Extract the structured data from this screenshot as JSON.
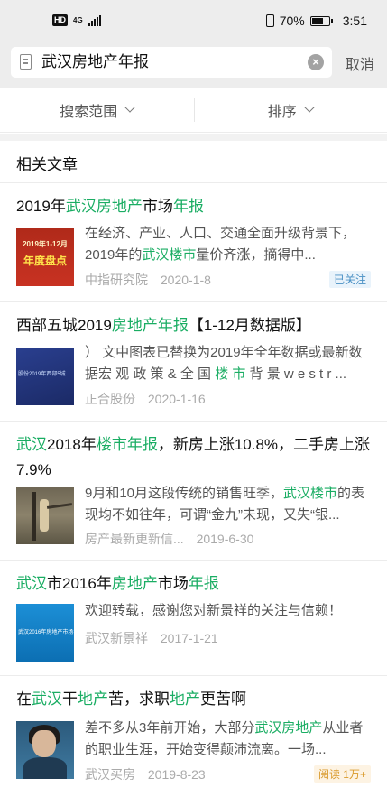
{
  "status_bar": {
    "hd_label": "HD",
    "network_label": "4G",
    "battery_text": "70%",
    "battery_level": 0.7,
    "time": "3:51"
  },
  "search": {
    "query": "武汉房地产年报",
    "cancel_label": "取消"
  },
  "filters": {
    "scope_label": "搜索范围",
    "sort_label": "排序"
  },
  "section_title": "相关文章",
  "articles": [
    {
      "title": [
        {
          "t": "2019年"
        },
        {
          "t": "武汉房地产",
          "hl": true
        },
        {
          "t": "市场"
        },
        {
          "t": "年报",
          "hl": true
        }
      ],
      "thumb_text": [
        "2019年1-12月",
        "年度盘点"
      ],
      "snippet": [
        {
          "t": "在经济、产业、人口、交通全面升级背景下，2019年的"
        },
        {
          "t": "武汉楼市",
          "hl": true
        },
        {
          "t": "量价齐涨，摘得中..."
        }
      ],
      "source": "中指研究院",
      "date": "2020-1-8",
      "badge": "已关注"
    },
    {
      "title": [
        {
          "t": "西部五城2019"
        },
        {
          "t": "房地产年报",
          "hl": true
        },
        {
          "t": "【1-12月数据版】"
        }
      ],
      "thumb_text": [
        "股份2019年西部5城"
      ],
      "snippet": [
        {
          "t": "） 文中图表已替换为2019年全年数据或最新数据宏 观 政 策 & 全 国 "
        },
        {
          "t": "楼 市",
          "hl": true
        },
        {
          "t": " 背 景 w e s t r ..."
        }
      ],
      "source": "正合股份",
      "date": "2020-1-16"
    },
    {
      "title": [
        {
          "t": "武汉",
          "hl": true
        },
        {
          "t": "2018年"
        },
        {
          "t": "楼市年报",
          "hl": true
        },
        {
          "t": "，新房上涨10.8%，二手房上涨7.9%"
        }
      ],
      "snippet": [
        {
          "t": "9月和10月这段传统的销售旺季，"
        },
        {
          "t": "武汉楼市",
          "hl": true
        },
        {
          "t": "的表现均不如往年，可谓“金九”未现，又失“银..."
        }
      ],
      "source": "房产最新更新信...",
      "date": "2019-6-30"
    },
    {
      "title": [
        {
          "t": "武汉",
          "hl": true
        },
        {
          "t": "市2016年"
        },
        {
          "t": "房地产",
          "hl": true
        },
        {
          "t": "市场"
        },
        {
          "t": "年报",
          "hl": true
        }
      ],
      "thumb_text": [
        "武汉2016年房地产市场年报"
      ],
      "snippet": [
        {
          "t": "欢迎转载，感谢您对新景祥的关注与信赖！"
        }
      ],
      "source": "武汉新景祥",
      "date": "2017-1-21"
    },
    {
      "title": [
        {
          "t": "在"
        },
        {
          "t": "武汉",
          "hl": true
        },
        {
          "t": "干"
        },
        {
          "t": "地产",
          "hl": true
        },
        {
          "t": "苦，求职"
        },
        {
          "t": "地产",
          "hl": true
        },
        {
          "t": "更苦啊"
        }
      ],
      "snippet": [
        {
          "t": "差不多从3年前开始，大部分"
        },
        {
          "t": "武汉房地产",
          "hl": true
        },
        {
          "t": "从业者的职业生涯，开始变得颠沛流离。一场..."
        }
      ],
      "source": "武汉买房",
      "date": "2019-8-23",
      "badge": "阅读 1万+"
    }
  ]
}
